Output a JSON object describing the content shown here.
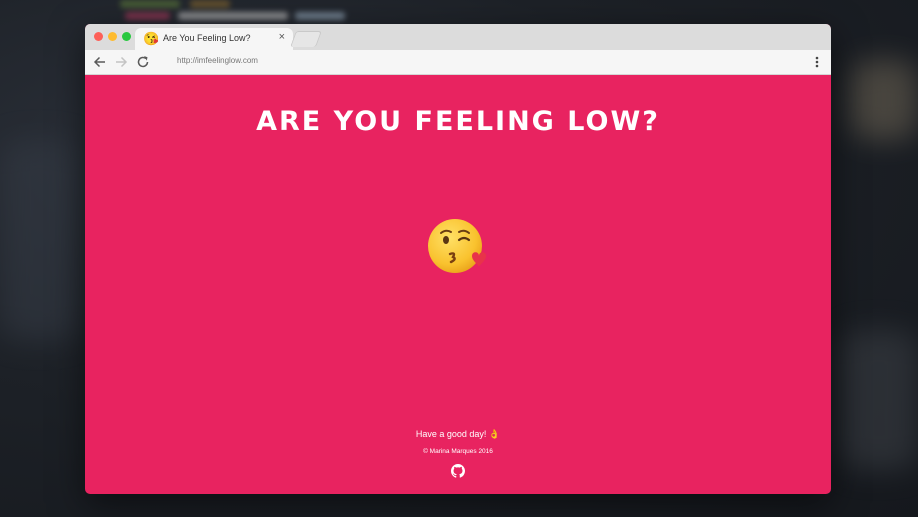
{
  "browser": {
    "tab": {
      "title": "Are You Feeling Low?",
      "favicon": "😘",
      "close_label": "×"
    },
    "url": "http://imfeelinglow.com",
    "icons": {
      "back": "arrow-left-icon",
      "forward": "arrow-right-icon",
      "reload": "reload-icon",
      "menu": "kebab-menu-icon"
    }
  },
  "page": {
    "headline": "ARE YOU FEELING LOW?",
    "emoji": "face-blowing-a-kiss-icon",
    "footer_message": "Have a good day! 👌",
    "copyright": "© Marina Marques 2016",
    "github_icon": "github-icon"
  },
  "colors": {
    "page_background": "#e82360",
    "text": "#ffffff"
  }
}
